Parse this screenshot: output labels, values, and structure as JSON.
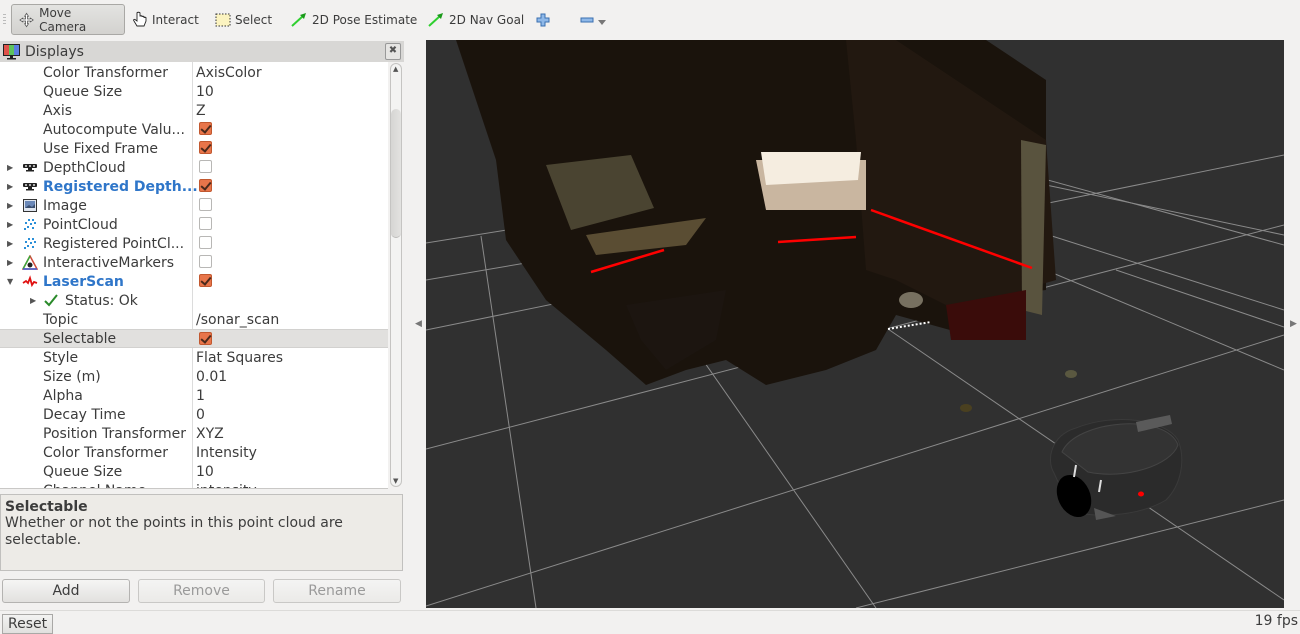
{
  "toolbar": {
    "tools": [
      {
        "label": "Move Camera",
        "icon": "move-camera-icon",
        "active": true
      },
      {
        "label": "Interact",
        "icon": "hand-pointer-icon",
        "active": false
      },
      {
        "label": "Select",
        "icon": "select-box-icon",
        "active": false
      },
      {
        "label": "2D Pose Estimate",
        "icon": "green-arrow-icon",
        "active": false
      },
      {
        "label": "2D Nav Goal",
        "icon": "green-arrow-icon",
        "active": false
      }
    ],
    "add_tool_icon": "plus-icon",
    "remove_tool_icon": "minus-icon"
  },
  "displays_panel": {
    "title": "Displays",
    "rows": [
      {
        "name": "Color Transformer",
        "value": "AxisColor"
      },
      {
        "name": "Queue Size",
        "value": "10"
      },
      {
        "name": "Axis",
        "value": "Z"
      },
      {
        "name": "Autocompute Valu...",
        "checked": true
      },
      {
        "name": "Use Fixed Frame",
        "checked": true
      },
      {
        "name": "DepthCloud",
        "checked": false,
        "expander": "collapsed",
        "icon": "depth-camera-icon"
      },
      {
        "name": "Registered Depth...",
        "checked": true,
        "expander": "collapsed",
        "icon": "depth-camera-icon",
        "highlight": true
      },
      {
        "name": "Image",
        "checked": false,
        "expander": "collapsed",
        "icon": "image-icon"
      },
      {
        "name": "PointCloud",
        "checked": false,
        "expander": "collapsed",
        "icon": "point-cloud-icon"
      },
      {
        "name": "Registered PointCl...",
        "checked": false,
        "expander": "collapsed",
        "icon": "point-cloud-icon"
      },
      {
        "name": "InteractiveMarkers",
        "checked": false,
        "expander": "collapsed",
        "icon": "interactive-markers-icon"
      },
      {
        "name": "LaserScan",
        "checked": true,
        "expander": "expanded",
        "icon": "laser-scan-icon",
        "highlight": true
      },
      {
        "name": "Status: Ok",
        "expander": "collapsed",
        "icon": "check-icon"
      },
      {
        "name": "Topic",
        "value": "/sonar_scan"
      },
      {
        "name": "Selectable",
        "checked": true,
        "selected": true
      },
      {
        "name": "Style",
        "value": "Flat Squares"
      },
      {
        "name": "Size (m)",
        "value": "0.01"
      },
      {
        "name": "Alpha",
        "value": "1"
      },
      {
        "name": "Decay Time",
        "value": "0"
      },
      {
        "name": "Position Transformer",
        "value": "XYZ"
      },
      {
        "name": "Color Transformer",
        "value": "Intensity"
      },
      {
        "name": "Queue Size",
        "value": "10"
      },
      {
        "name": "Channel Name",
        "value": "intensity"
      }
    ],
    "scroll_position": 0.12
  },
  "description": {
    "title": "Selectable",
    "text": "Whether or not the points in this point cloud are selectable."
  },
  "buttons": {
    "add": "Add",
    "remove": "Remove",
    "rename": "Rename"
  },
  "statusbar": {
    "reset": "Reset",
    "fps": "19 fps"
  },
  "colors": {
    "checkbox_on": "#e8754a",
    "highlight_text": "#2f76c9",
    "view_background": "#303030",
    "laser_scan": "#ff0000"
  }
}
